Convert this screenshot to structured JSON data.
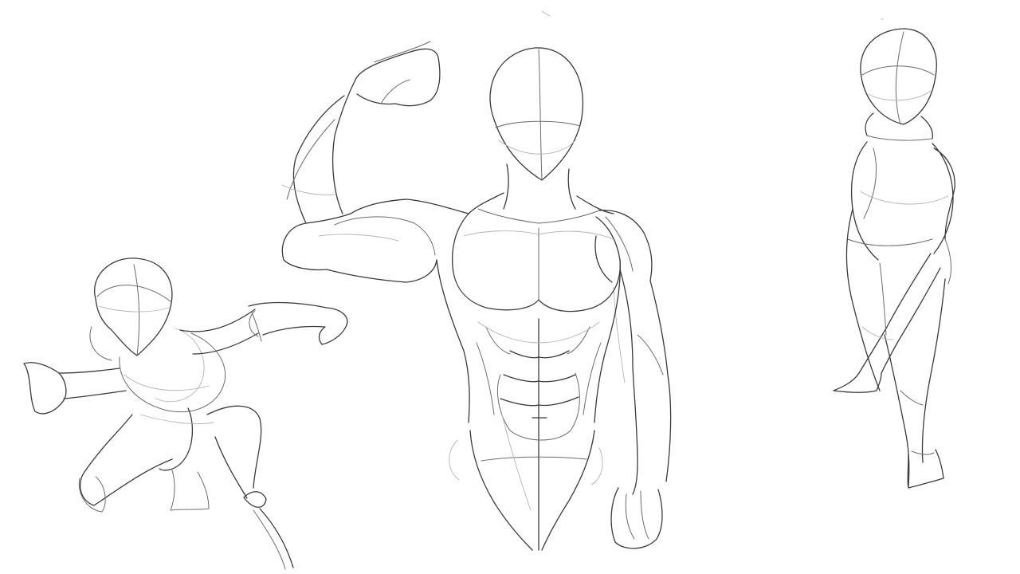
{
  "canvas": {
    "background": "#ffffff",
    "ink_dark": "#3a3a3a",
    "ink_mid": "#6b6b6b",
    "ink_light": "#b3b3b3"
  },
  "figures": [
    {
      "name": "crouching-mannequin-figure"
    },
    {
      "name": "muscular-torso-figure"
    },
    {
      "name": "standing-mannequin-figure"
    }
  ]
}
